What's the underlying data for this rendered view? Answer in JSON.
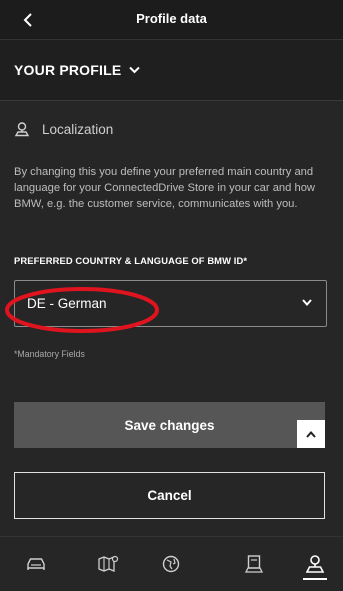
{
  "header": {
    "title": "Profile data"
  },
  "profile": {
    "title": "YOUR PROFILE"
  },
  "section": {
    "title": "Localization",
    "description": "By changing this you define your preferred main country and language for your ConnectedDrive Store in your car and how BMW, e.g. the customer service, communicates with you."
  },
  "field": {
    "label": "PREFERRED COUNTRY & LANGUAGE OF BMW ID*",
    "value": "DE - German"
  },
  "mandatory_note": "*Mandatory Fields",
  "buttons": {
    "save": "Save changes",
    "cancel": "Cancel"
  },
  "nav": {
    "items": [
      {
        "icon": "car-icon"
      },
      {
        "icon": "map-icon"
      },
      {
        "icon": "globe-icon"
      },
      {
        "icon": "service-icon"
      },
      {
        "icon": "profile-icon",
        "active": true
      }
    ]
  },
  "colors": {
    "background": "#262626",
    "highlight": "#e0141e",
    "accent": "#ffffff"
  }
}
